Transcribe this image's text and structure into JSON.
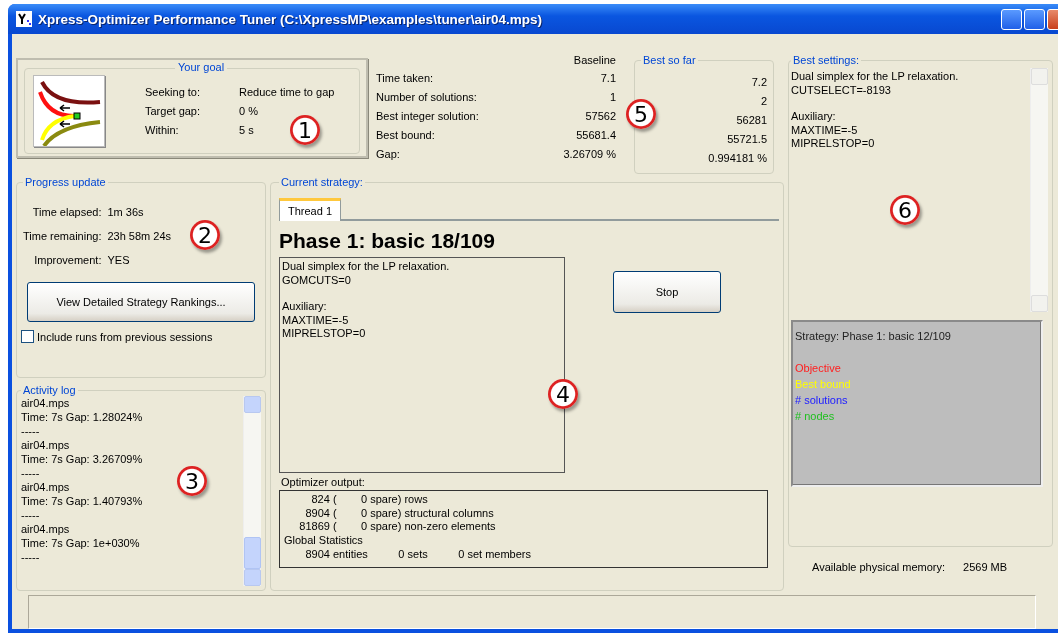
{
  "window": {
    "title": "Xpress-Optimizer Performance Tuner (C:\\XpressMP\\examples\\tuner\\air04.mps)"
  },
  "goal": {
    "title": "Your goal",
    "rows": [
      {
        "label": "Seeking to:",
        "value": "Reduce time to gap"
      },
      {
        "label": "Target gap:",
        "value": "0 %"
      },
      {
        "label": "Within:",
        "value": "5 s"
      }
    ]
  },
  "results": {
    "baseline_heading": "Baseline",
    "best_title": "Best so far",
    "rows": [
      {
        "label": "Time taken:",
        "baseline": "7.1",
        "best": "7.2"
      },
      {
        "label": "Number of solutions:",
        "baseline": "1",
        "best": "2"
      },
      {
        "label": "Best integer solution:",
        "baseline": "57562",
        "best": "56281"
      },
      {
        "label": "Best bound:",
        "baseline": "55681.4",
        "best": "55721.5"
      },
      {
        "label": "Gap:",
        "baseline": "3.26709 %",
        "best": "0.994181 %"
      }
    ]
  },
  "progress": {
    "title": "Progress update",
    "rows": [
      {
        "label": "Time elapsed:",
        "value": "1m 36s"
      },
      {
        "label": "Time remaining:",
        "value": "23h 58m 24s"
      },
      {
        "label": "Improvement:",
        "value": "YES"
      }
    ],
    "button": "View Detailed Strategy Rankings...",
    "include_previous": {
      "label": "Include runs from previous sessions",
      "checked": false
    }
  },
  "activity_log": {
    "title": "Activity log",
    "entries": [
      {
        "file": "air04.mps",
        "stats": "Time: 7s  Gap: 1.28024%",
        "separator": "-----"
      },
      {
        "file": "air04.mps",
        "stats": "Time: 7s  Gap: 3.26709%",
        "separator": "-----"
      },
      {
        "file": "air04.mps",
        "stats": "Time: 7s  Gap: 1.40793%",
        "separator": "-----"
      },
      {
        "file": "air04.mps",
        "stats": "Time: 7s  Gap: 1e+030%",
        "separator": "-----"
      }
    ]
  },
  "current_strategy": {
    "title": "Current strategy:",
    "tabs": [
      {
        "label": "Thread 1",
        "selected": true
      }
    ],
    "phase": "Phase 1: basic 18/109",
    "settings": [
      [
        "Dual simplex for the LP relaxation.",
        "GOMCUTS=0"
      ],
      [
        "Auxiliary:",
        "MAXTIME=-5",
        "MIPRELSTOP=0"
      ]
    ],
    "stop_button": "Stop",
    "output_title": "Optimizer output:",
    "output_lines": [
      "         824 (        0 spare) rows",
      "       8904 (        0 spare) structural columns",
      "     81869 (        0 spare) non-zero elements",
      "Global Statistics",
      "       8904 entities          0 sets          0 set members"
    ]
  },
  "best_settings": {
    "title": "Best settings:",
    "settings": [
      [
        "Dual simplex for the LP relaxation.",
        "CUTSELECT=-8193"
      ],
      [
        "Auxiliary:",
        "MAXTIME=-5",
        "MIPRELSTOP=0"
      ]
    ]
  },
  "strategy_chart": {
    "title": "Strategy: Phase 1: basic 12/109",
    "legend": [
      {
        "label": "Objective",
        "color": "#ff2020"
      },
      {
        "label": "Best bound",
        "color": "#ffff00"
      },
      {
        "label": "# solutions",
        "color": "#2020ff"
      },
      {
        "label": "# nodes",
        "color": "#20c020"
      }
    ]
  },
  "memory": {
    "label": "Available physical memory:",
    "value": "2569 MB"
  },
  "callouts": [
    "1",
    "2",
    "3",
    "4",
    "5",
    "6"
  ]
}
